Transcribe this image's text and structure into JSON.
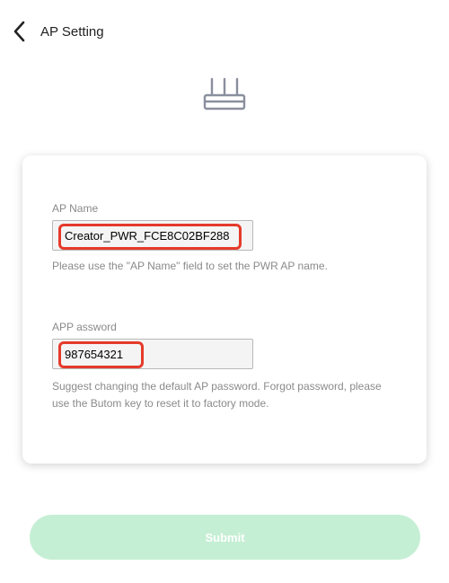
{
  "header": {
    "title": "AP Setting",
    "back_icon": "chevron-left-icon"
  },
  "hero": {
    "icon": "router-icon"
  },
  "form": {
    "ap_name": {
      "label": "AP Name",
      "value": "Creator_PWR_FCE8C02BF288",
      "hint": "Please use the \"AP Name\" field to set the PWR AP name."
    },
    "ap_password": {
      "label": "APP assword",
      "value": "987654321",
      "hint": "Suggest changing the default AP password. Forgot password, please use the Butom key to reset it to factory mode."
    }
  },
  "submit": {
    "label": "Submit"
  },
  "colors": {
    "highlight": "#e53a2a",
    "submit_bg": "#c5efd4",
    "label_text": "#8a8a8a",
    "icon_stroke": "#8a8f9e"
  }
}
